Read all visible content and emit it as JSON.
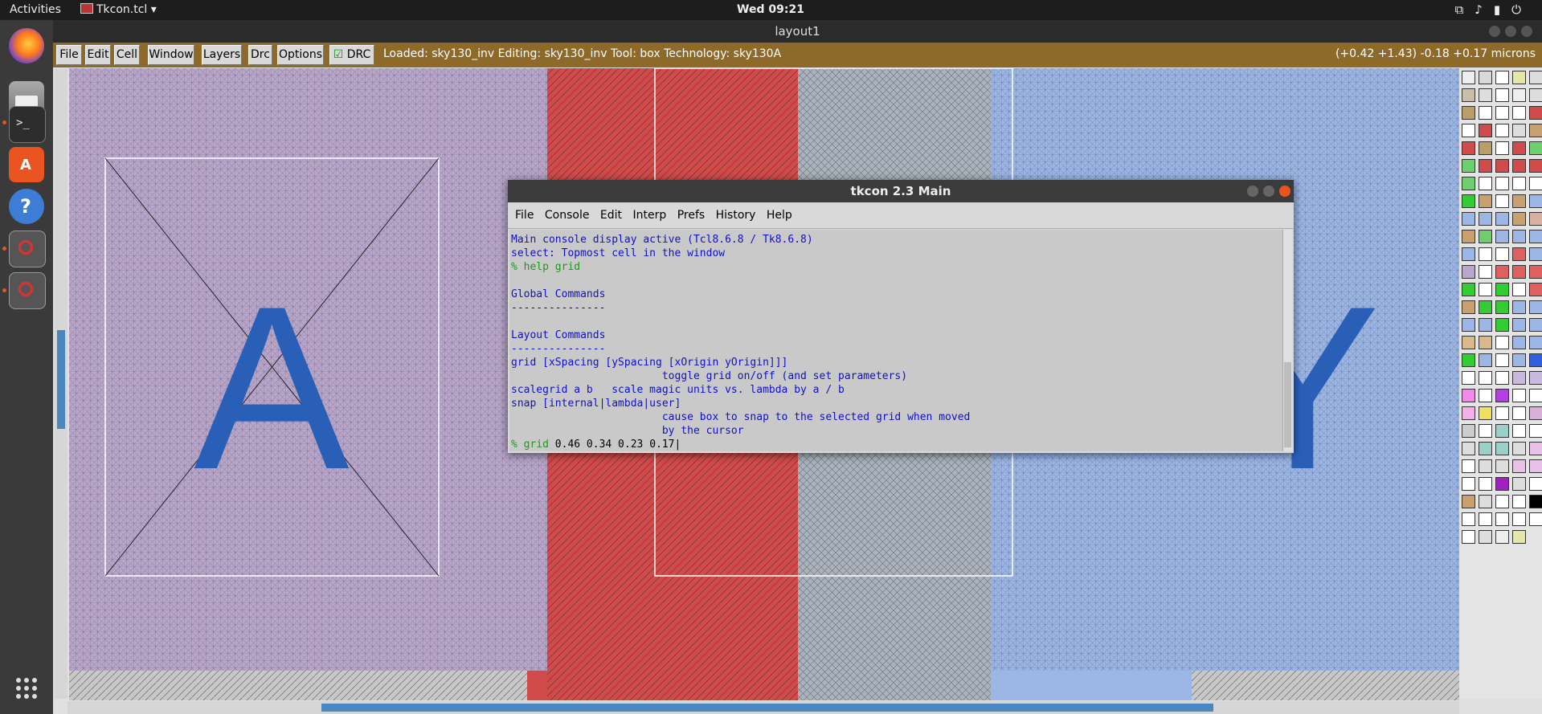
{
  "topbar": {
    "activities": "Activities",
    "app_name": "Tkcon.tcl ▾",
    "clock": "Wed 09:21",
    "tray_icons": [
      "network-icon",
      "volume-icon",
      "battery-icon",
      "power-icon"
    ]
  },
  "dock": {
    "apps": [
      "firefox-icon",
      "files-icon",
      "terminal-icon",
      "software-icon",
      "help-icon",
      "magic-icon",
      "magic-icon-2",
      "app-grid-icon"
    ]
  },
  "window": {
    "title": "layout1"
  },
  "magic_menu": {
    "buttons": [
      "File",
      "Edit",
      "Cell",
      "Window",
      "Layers",
      "Drc",
      "Options"
    ],
    "drc_toggle": "DRC",
    "status": "Loaded: sky130_inv Editing: sky130_inv Tool: box  Technology: sky130A",
    "coords": "(+0.42 +1.43) -0.18 +0.17 microns"
  },
  "canvas": {
    "label_a": "A",
    "label_y": "Y"
  },
  "tkcon": {
    "title": "tkcon 2.3 Main",
    "menu": [
      "File",
      "Console",
      "Edit",
      "Interp",
      "Prefs",
      "History",
      "Help"
    ],
    "lines": {
      "l1": "Main console display active (Tcl8.6.8 / Tk8.6.8)",
      "l2": "select: Topmost cell in the window",
      "l3_prompt": "%",
      "l3_cmd": "help grid",
      "l4": "",
      "l5": "Global Commands",
      "l6": "---------------",
      "l7": "",
      "l8": "Layout Commands",
      "l9": "---------------",
      "l10": "grid [xSpacing [ySpacing [xOrigin yOrigin]]]",
      "l11": "                        toggle grid on/off (and set parameters)",
      "l12": "scalegrid a b   scale magic units vs. lambda by a / b",
      "l13": "snap [internal|lambda|user]",
      "l14": "                        cause box to snap to the selected grid when moved",
      "l15": "                        by the cursor",
      "l16_prompt": "%",
      "l16_cmd": "grid",
      "l16_args": " 0.46 0.34 0.23 0.17"
    }
  },
  "colors": {
    "menubar": "#8d6a2a",
    "ndiff": "#b9a6ca",
    "poly": "#d24b4b",
    "metal": "#aab3bd",
    "pdiff": "#9cb6e6",
    "label": "#2a5fb8"
  }
}
